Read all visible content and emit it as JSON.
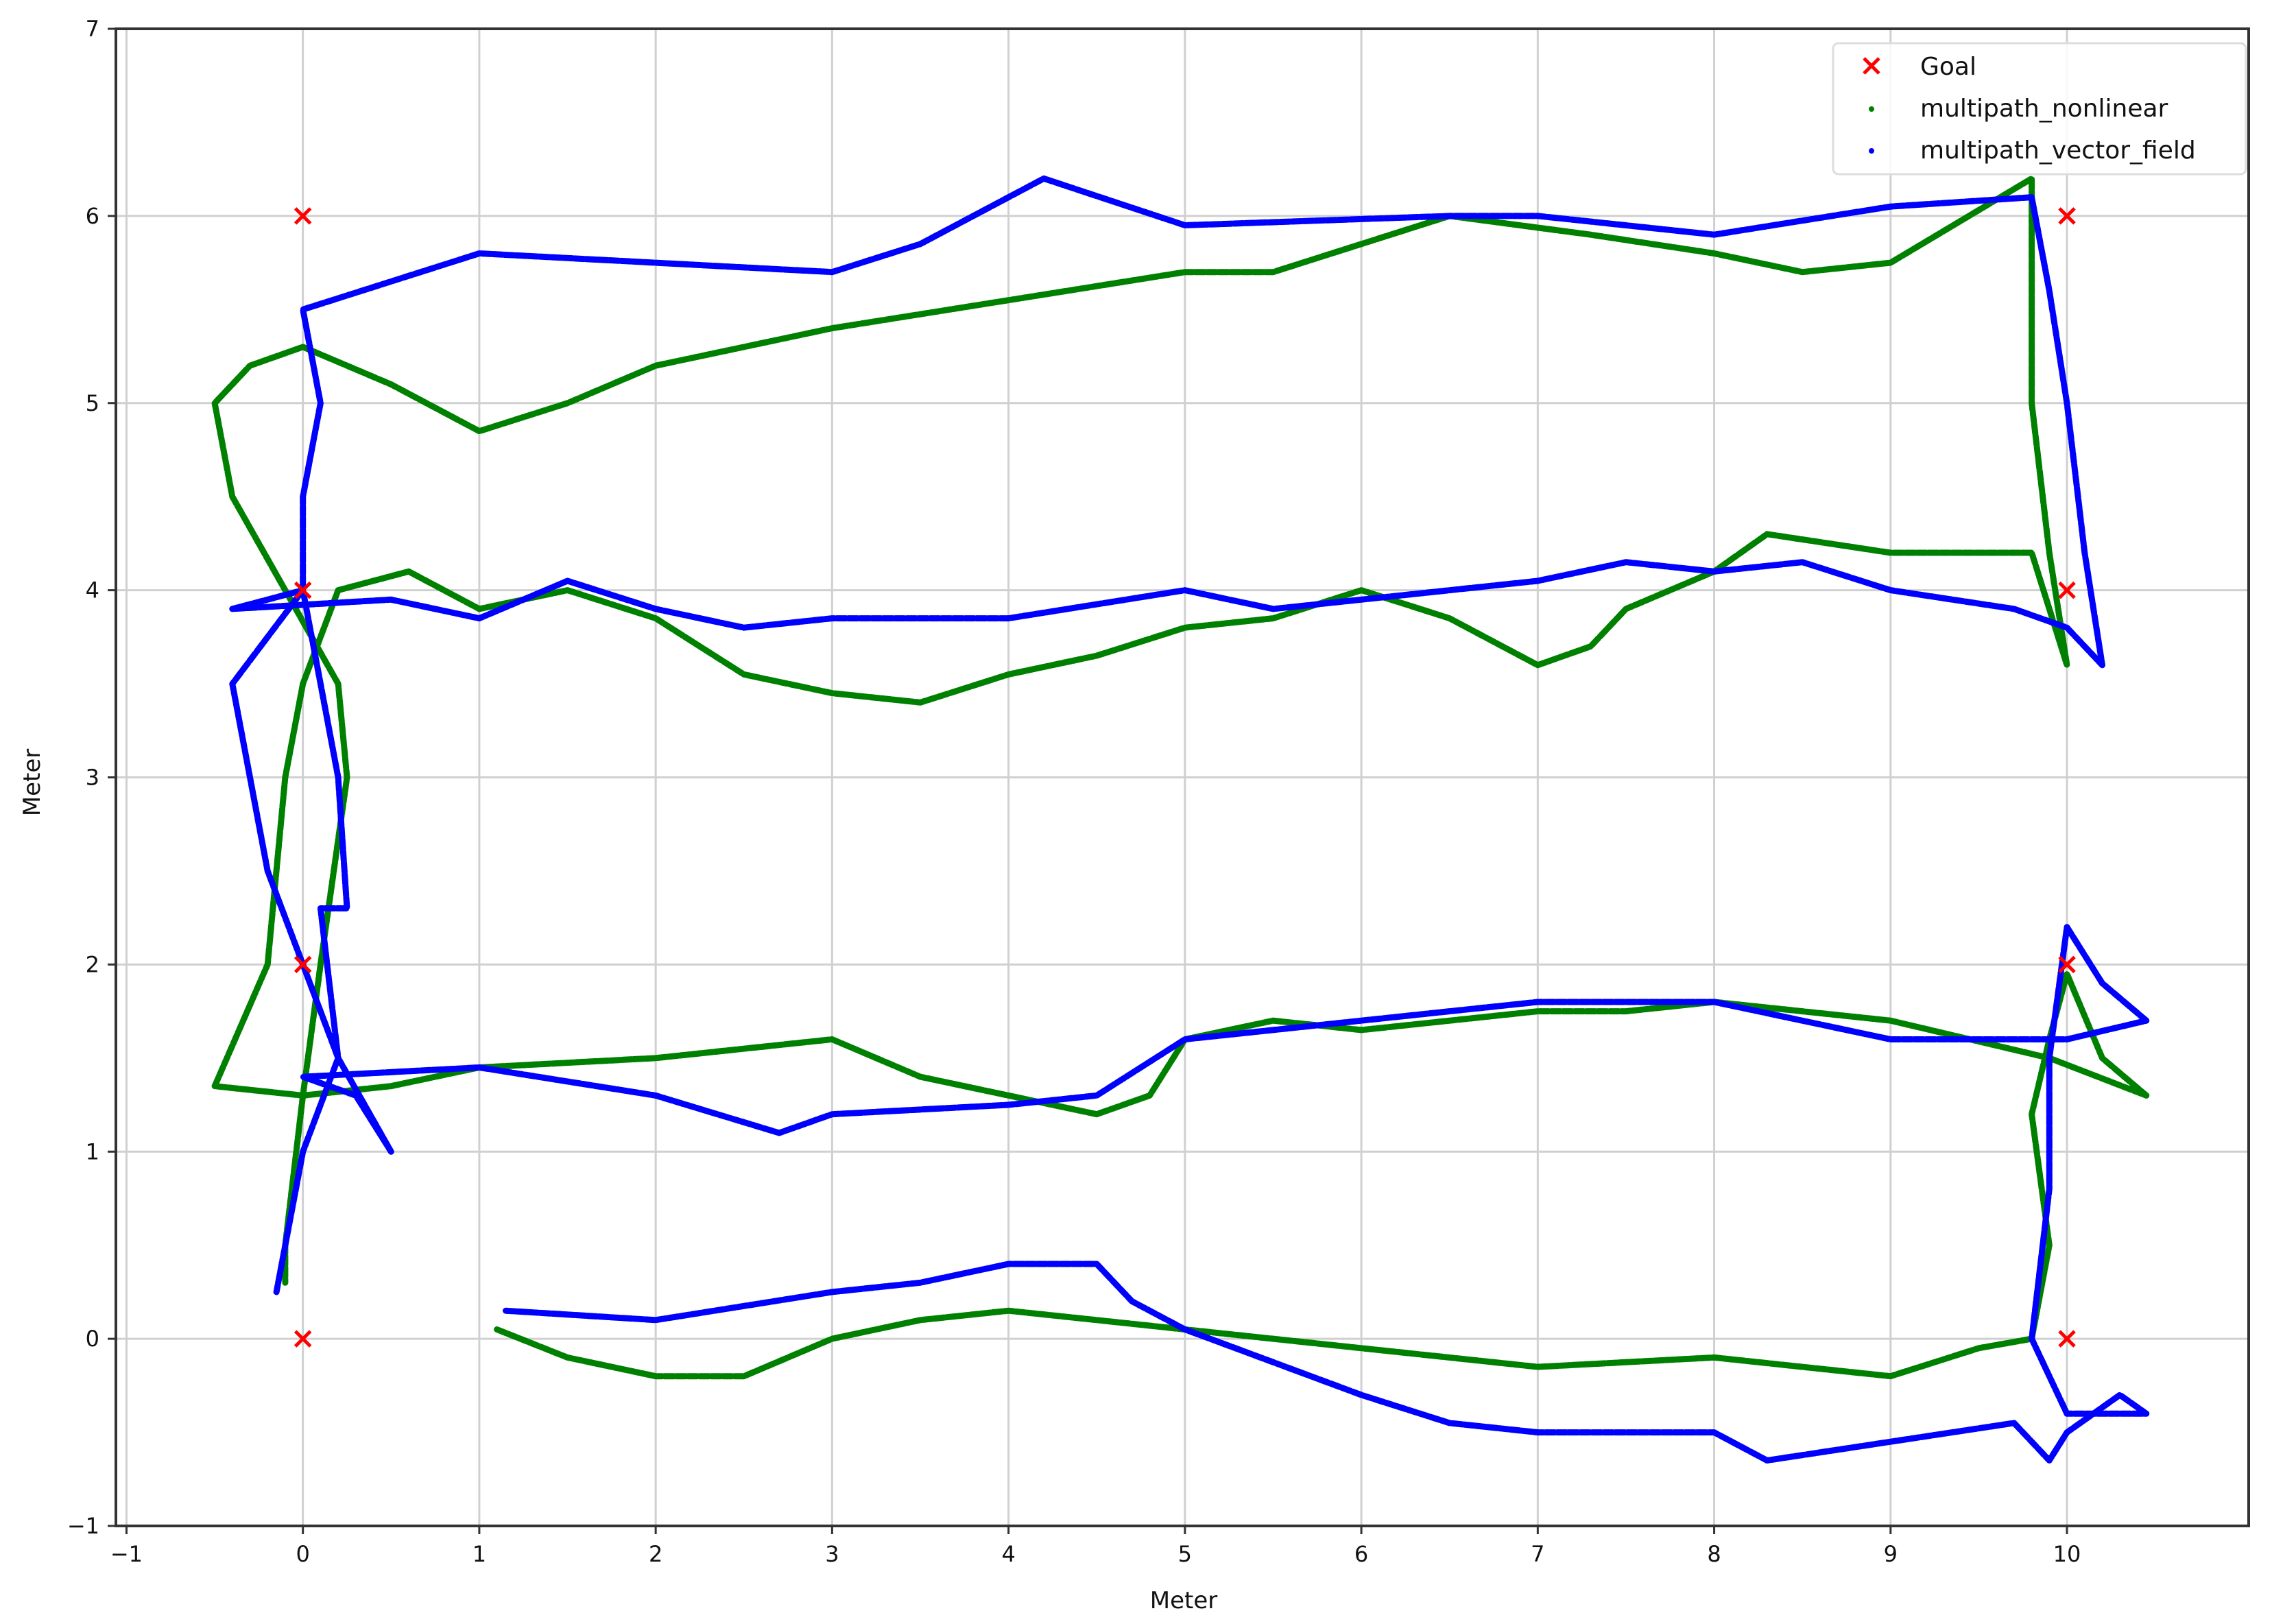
{
  "chart_data": {
    "type": "scatter",
    "title": "",
    "xlabel": "Meter",
    "ylabel": "Meter",
    "xlim": [
      -1.06,
      11.03
    ],
    "ylim": [
      -1,
      7
    ],
    "xticks": [
      -1,
      0,
      1,
      2,
      3,
      4,
      5,
      6,
      7,
      8,
      9,
      10
    ],
    "yticks": [
      -1,
      0,
      1,
      2,
      3,
      4,
      5,
      6,
      7
    ],
    "grid": true,
    "legend_position": "top-right",
    "colors": {
      "goal": "#ff0000",
      "nonlinear": "#008000",
      "vector_field": "#0000ff"
    },
    "legend": [
      "Goal",
      "multipath_nonlinear",
      "multipath_vector_field"
    ],
    "goals": [
      [
        0,
        6
      ],
      [
        0,
        4
      ],
      [
        0,
        2
      ],
      [
        0,
        0
      ],
      [
        10,
        6
      ],
      [
        10,
        4
      ],
      [
        10,
        2
      ],
      [
        10,
        0
      ]
    ],
    "series": [
      {
        "name": "multipath_nonlinear",
        "color": "#008000",
        "points": [
          [
            1.1,
            0.05
          ],
          [
            1.5,
            -0.1
          ],
          [
            2,
            -0.2
          ],
          [
            2.5,
            -0.2
          ],
          [
            3,
            0
          ],
          [
            3.5,
            0.1
          ],
          [
            4,
            0.15
          ],
          [
            4.5,
            0.1
          ],
          [
            5,
            0.05
          ],
          [
            6,
            -0.05
          ],
          [
            7,
            -0.15
          ],
          [
            8,
            -0.1
          ],
          [
            8.5,
            -0.15
          ],
          [
            9,
            -0.2
          ],
          [
            9.5,
            -0.05
          ],
          [
            9.8,
            0
          ],
          [
            9.9,
            0.5
          ],
          [
            9.8,
            1.2
          ],
          [
            9.9,
            1.6
          ],
          [
            10,
            1.95
          ],
          [
            10.2,
            1.5
          ],
          [
            10.45,
            1.3
          ],
          [
            9.9,
            1.5
          ],
          [
            9,
            1.7
          ],
          [
            8.5,
            1.75
          ],
          [
            8,
            1.8
          ],
          [
            7.5,
            1.75
          ],
          [
            7,
            1.75
          ],
          [
            6,
            1.65
          ],
          [
            5.5,
            1.7
          ],
          [
            5,
            1.6
          ],
          [
            4.8,
            1.3
          ],
          [
            4.5,
            1.2
          ],
          [
            4,
            1.3
          ],
          [
            3.5,
            1.4
          ],
          [
            3,
            1.6
          ],
          [
            2,
            1.5
          ],
          [
            1,
            1.45
          ],
          [
            0.5,
            1.35
          ],
          [
            0,
            1.3
          ],
          [
            -0.5,
            1.35
          ],
          [
            -0.2,
            2
          ],
          [
            -0.1,
            3
          ],
          [
            0,
            3.5
          ],
          [
            0.2,
            4
          ],
          [
            0.6,
            4.1
          ],
          [
            1,
            3.9
          ],
          [
            1.5,
            4.0
          ],
          [
            2,
            3.85
          ],
          [
            2.5,
            3.55
          ],
          [
            3,
            3.45
          ],
          [
            3.5,
            3.4
          ],
          [
            4,
            3.55
          ],
          [
            4.5,
            3.65
          ],
          [
            5,
            3.8
          ],
          [
            5.5,
            3.85
          ],
          [
            6,
            4.0
          ],
          [
            6.5,
            3.85
          ],
          [
            7,
            3.6
          ],
          [
            7.3,
            3.7
          ],
          [
            7.5,
            3.9
          ],
          [
            8,
            4.1
          ],
          [
            8.3,
            4.3
          ],
          [
            9,
            4.2
          ],
          [
            9.8,
            4.2
          ],
          [
            10,
            3.6
          ],
          [
            9.9,
            4.2
          ],
          [
            9.8,
            5
          ],
          [
            9.8,
            5.8
          ],
          [
            9.8,
            6.2
          ],
          [
            9,
            5.75
          ],
          [
            8.5,
            5.7
          ],
          [
            8,
            5.8
          ],
          [
            7.3,
            5.9
          ],
          [
            6.5,
            6.0
          ],
          [
            6,
            5.85
          ],
          [
            5.5,
            5.7
          ],
          [
            5,
            5.7
          ],
          [
            4,
            5.55
          ],
          [
            3,
            5.4
          ],
          [
            2,
            5.2
          ],
          [
            1.5,
            5.0
          ],
          [
            1,
            4.85
          ],
          [
            0.5,
            5.1
          ],
          [
            0,
            5.3
          ],
          [
            -0.3,
            5.2
          ],
          [
            -0.5,
            5.0
          ],
          [
            -0.4,
            4.5
          ],
          [
            -0.1,
            4
          ],
          [
            0.2,
            3.5
          ],
          [
            0.25,
            3.0
          ],
          [
            0.1,
            2.0
          ],
          [
            0,
            1.3
          ],
          [
            -0.1,
            0.5
          ],
          [
            -0.1,
            0.3
          ]
        ]
      },
      {
        "name": "multipath_vector_field",
        "color": "#0000ff",
        "points": [
          [
            1.15,
            0.15
          ],
          [
            2,
            0.1
          ],
          [
            3,
            0.25
          ],
          [
            3.5,
            0.3
          ],
          [
            4,
            0.4
          ],
          [
            4.5,
            0.4
          ],
          [
            4.7,
            0.2
          ],
          [
            5,
            0.05
          ],
          [
            6,
            -0.3
          ],
          [
            6.5,
            -0.45
          ],
          [
            7,
            -0.5
          ],
          [
            8,
            -0.5
          ],
          [
            8.3,
            -0.65
          ],
          [
            9,
            -0.55
          ],
          [
            9.7,
            -0.45
          ],
          [
            9.9,
            -0.65
          ],
          [
            10,
            -0.5
          ],
          [
            10.3,
            -0.3
          ],
          [
            10.45,
            -0.4
          ],
          [
            10.0,
            -0.4
          ],
          [
            9.8,
            0
          ],
          [
            9.9,
            0.8
          ],
          [
            9.9,
            1.5
          ],
          [
            10,
            2.2
          ],
          [
            10.2,
            1.9
          ],
          [
            10.45,
            1.7
          ],
          [
            10,
            1.6
          ],
          [
            9,
            1.6
          ],
          [
            8,
            1.8
          ],
          [
            7,
            1.8
          ],
          [
            6,
            1.7
          ],
          [
            5,
            1.6
          ],
          [
            4.5,
            1.3
          ],
          [
            4,
            1.25
          ],
          [
            3,
            1.2
          ],
          [
            2.7,
            1.1
          ],
          [
            2,
            1.3
          ],
          [
            1,
            1.45
          ],
          [
            0,
            1.4
          ],
          [
            0.3,
            1.3
          ],
          [
            0.5,
            1.0
          ],
          [
            0.2,
            1.5
          ],
          [
            0.1,
            2.3
          ],
          [
            0.25,
            2.3
          ],
          [
            0.2,
            3
          ],
          [
            0,
            4
          ],
          [
            -0.4,
            3.9
          ],
          [
            0.5,
            3.95
          ],
          [
            1,
            3.85
          ],
          [
            1.5,
            4.05
          ],
          [
            2,
            3.9
          ],
          [
            2.5,
            3.8
          ],
          [
            3,
            3.85
          ],
          [
            4,
            3.85
          ],
          [
            5,
            4.0
          ],
          [
            5.5,
            3.9
          ],
          [
            6,
            3.95
          ],
          [
            7,
            4.05
          ],
          [
            7.5,
            4.15
          ],
          [
            8,
            4.1
          ],
          [
            8.5,
            4.15
          ],
          [
            9,
            4.0
          ],
          [
            9.7,
            3.9
          ],
          [
            10,
            3.8
          ],
          [
            10.2,
            3.6
          ],
          [
            10.1,
            4.2
          ],
          [
            10,
            5
          ],
          [
            9.9,
            5.6
          ],
          [
            9.8,
            6.1
          ],
          [
            9,
            6.05
          ],
          [
            8,
            5.9
          ],
          [
            7,
            6.0
          ],
          [
            6.5,
            6.0
          ],
          [
            5,
            5.95
          ],
          [
            4.2,
            6.2
          ],
          [
            3.5,
            5.85
          ],
          [
            3,
            5.7
          ],
          [
            2,
            5.75
          ],
          [
            1,
            5.8
          ],
          [
            0.5,
            5.65
          ],
          [
            0,
            5.5
          ],
          [
            0.1,
            5
          ],
          [
            0,
            4.5
          ],
          [
            0,
            4
          ],
          [
            -0.4,
            3.5
          ],
          [
            -0.2,
            2.5
          ],
          [
            0,
            2
          ],
          [
            0.2,
            1.5
          ],
          [
            0,
            1.0
          ],
          [
            -0.15,
            0.25
          ]
        ]
      }
    ]
  }
}
